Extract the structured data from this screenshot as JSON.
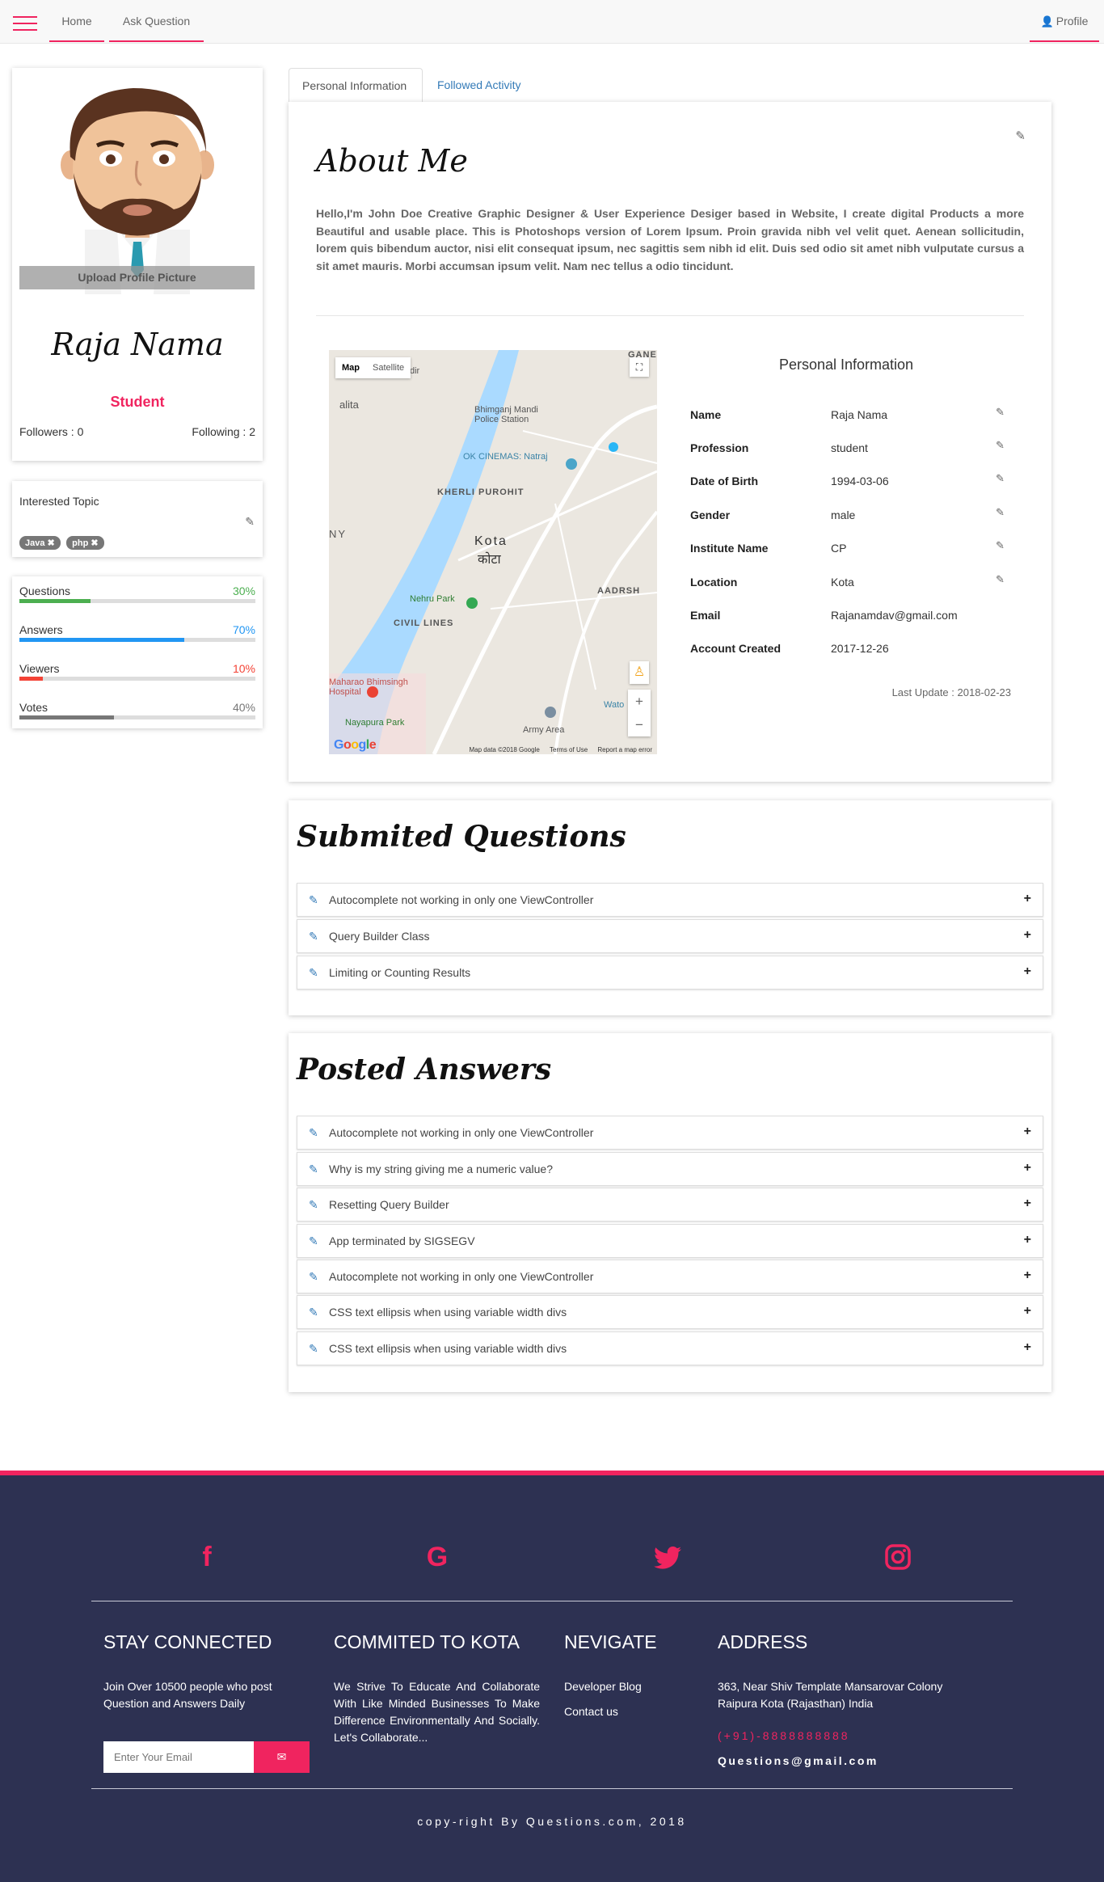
{
  "nav": {
    "home": "Home",
    "ask_question": "Ask Question",
    "profile": "Profile"
  },
  "profile": {
    "upload_label": "Upload Profile Picture",
    "name": "Raja Nama",
    "role": "Student",
    "followers": "Followers : 0",
    "following": "Following : 2"
  },
  "topics": {
    "title": "Interested Topic",
    "tags": [
      "Java",
      "php"
    ]
  },
  "stats": [
    {
      "label": "Questions",
      "percent_text": "30%",
      "value": 30,
      "color": "#4caf50"
    },
    {
      "label": "Answers",
      "percent_text": "70%",
      "value": 70,
      "color": "#2196f3"
    },
    {
      "label": "Viewers",
      "percent_text": "10%",
      "value": 10,
      "color": "#f44336"
    },
    {
      "label": "Votes",
      "percent_text": "40%",
      "value": 40,
      "color": "#777777"
    }
  ],
  "tabs": {
    "personal": "Personal Information",
    "followed": "Followed Activity"
  },
  "about": {
    "title": "About Me",
    "text": "Hello,I'm John Doe Creative Graphic Designer & User Experience Desiger based in Website, I create digital Products a more Beautiful and usable place. This is Photoshops version of Lorem Ipsum. Proin gravida nibh vel velit quet. Aenean sollicitudin, lorem quis bibendum auctor, nisi elit consequat ipsum, nec sagittis sem nibh id elit. Duis sed odio sit amet nibh vulputate cursus a sit amet mauris. Morbi accumsan ipsum velit. Nam nec tellus a odio tincidunt."
  },
  "map": {
    "tab_map": "Map",
    "tab_satellite": "Satellite",
    "data_label": "Map data ©2018 Google",
    "terms": "Terms of Use",
    "report": "Report a map error",
    "logo": "Google",
    "labels": [
      "Kota",
      "कोटा",
      "KHERLI PUROHIT",
      "CIVIL LINES",
      "Nehru Park",
      "Nayapura Park",
      "Army Area",
      "AADRSH",
      "Bhimganj Mandi Police Station",
      "OK CINEMAS: Natraj",
      "Maharao Bhimsingh Hospital",
      "GANE",
      "alita",
      "dir",
      "NY",
      "Wato"
    ]
  },
  "personal_info": {
    "title": "Personal Information",
    "rows": [
      {
        "key": "Name",
        "value": "Raja Nama",
        "editable": true
      },
      {
        "key": "Profession",
        "value": "student",
        "editable": true
      },
      {
        "key": "Date of Birth",
        "value": "1994-03-06",
        "editable": true
      },
      {
        "key": "Gender",
        "value": "male",
        "editable": true
      },
      {
        "key": "Institute Name",
        "value": "CP",
        "editable": true
      },
      {
        "key": "Location",
        "value": "Kota",
        "editable": true
      },
      {
        "key": "Email",
        "value": "Rajanamdav@gmail.com",
        "editable": false
      },
      {
        "key": "Account Created",
        "value": "2017-12-26",
        "editable": false
      }
    ],
    "last_update": "Last Update : 2018-02-23"
  },
  "questions": {
    "title": "Submited Questions",
    "items": [
      "Autocomplete not working in only one ViewController",
      "Query Builder Class",
      "Limiting or Counting Results"
    ]
  },
  "answers": {
    "title": "Posted Answers",
    "items": [
      "Autocomplete not working in only one ViewController",
      "Why is my string giving me a numeric value?",
      "Resetting Query Builder",
      "App terminated by SIGSEGV",
      "Autocomplete not working in only one ViewController",
      "CSS text ellipsis when using variable width divs",
      "CSS text ellipsis when using variable width divs"
    ]
  },
  "footer": {
    "social": [
      "facebook-icon",
      "google-icon",
      "twitter-icon",
      "instagram-icon"
    ],
    "stay_title": "STAY CONNECTED",
    "stay_text": "Join Over 10500 people who post Question and Answers Daily",
    "email_placeholder": "Enter Your Email",
    "commit_title": "COMMITED TO KOTA",
    "commit_text": "We Strive To Educate And Collaborate With Like Minded Businesses To Make Difference Environmentally And Socially. Let's Collaborate...",
    "nav_title": "NEVIGATE",
    "nav_links": [
      "Developer Blog",
      "Contact us"
    ],
    "address_title": "ADDRESS",
    "address_line1": "363, Near Shiv Template Mansarovar Colony",
    "address_line2": "Raipura Kota (Rajasthan) India",
    "phone": "(+91)-8888888888",
    "email": "Questions@gmail.com",
    "copyright": "copy-right By Questions.com, 2018"
  },
  "colors": {
    "accent": "#f0245f",
    "footer_bg": "#2d3152",
    "link": "#337ab7"
  }
}
